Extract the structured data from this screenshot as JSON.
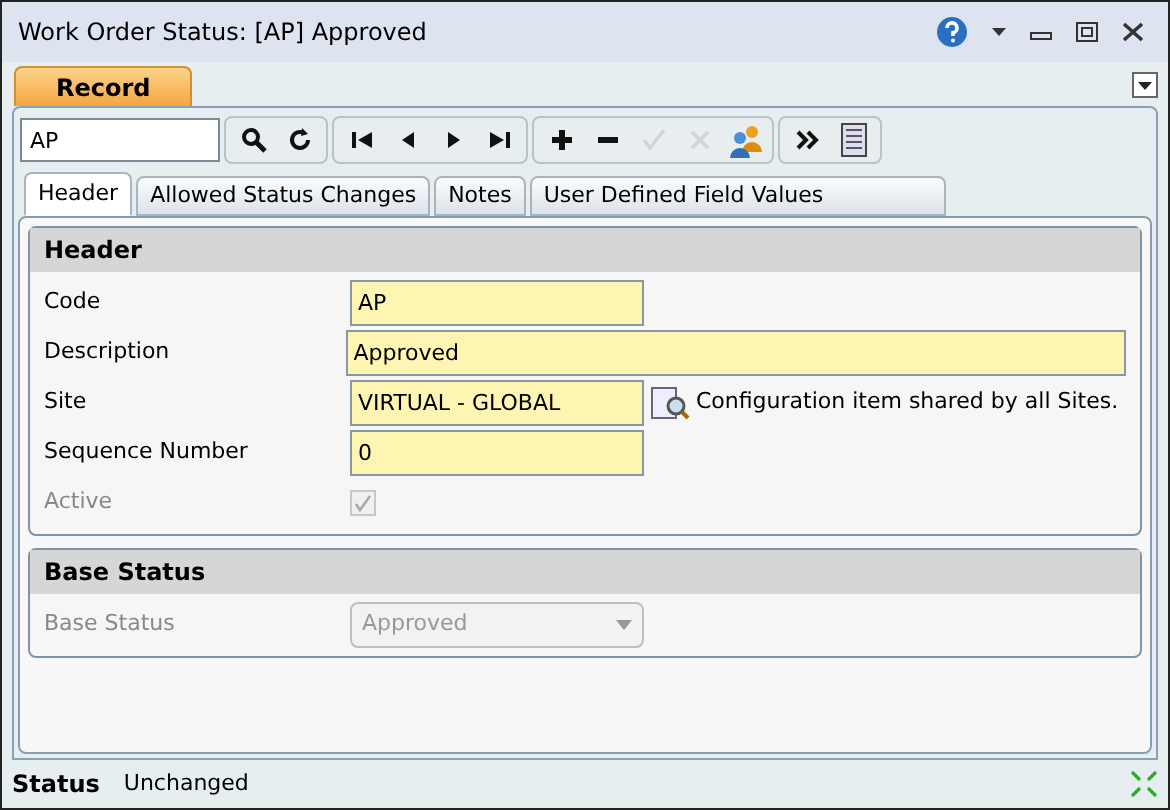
{
  "window": {
    "title": "Work Order Status: [AP] Approved"
  },
  "record_tab": {
    "label": "Record",
    "selected": true
  },
  "search": {
    "value": "AP"
  },
  "toolbar": [
    {
      "kind": "search",
      "disabled": false
    },
    {
      "kind": "refresh",
      "disabled": false
    },
    {
      "kind": "sep"
    },
    {
      "kind": "first",
      "disabled": false
    },
    {
      "kind": "prev",
      "disabled": false
    },
    {
      "kind": "next",
      "disabled": false
    },
    {
      "kind": "last",
      "disabled": false
    },
    {
      "kind": "sep"
    },
    {
      "kind": "add",
      "disabled": false
    },
    {
      "kind": "remove",
      "disabled": false
    },
    {
      "kind": "save",
      "disabled": true
    },
    {
      "kind": "cancel",
      "disabled": true
    },
    {
      "kind": "users",
      "disabled": false
    },
    {
      "kind": "sep"
    },
    {
      "kind": "more",
      "disabled": false
    },
    {
      "kind": "list",
      "disabled": false
    }
  ],
  "tabs": [
    {
      "label": "Header",
      "selected": true
    },
    {
      "label": "Allowed Status Changes",
      "selected": false
    },
    {
      "label": "Notes",
      "selected": false
    },
    {
      "label": "User Defined Field Values",
      "selected": false
    }
  ],
  "sections": [
    {
      "title": "Header",
      "fields": [
        {
          "kind": "short",
          "label": "Code",
          "value": "AP",
          "disabled": false
        },
        {
          "kind": "wide",
          "label": "Description",
          "value": "Approved",
          "disabled": false
        },
        {
          "kind": "short",
          "label": "Site",
          "value": "VIRTUAL - GLOBAL",
          "disabled": false,
          "note": "Configuration item shared by all Sites."
        },
        {
          "kind": "short",
          "label": "Sequence Number",
          "value": "0",
          "disabled": false
        },
        {
          "kind": "checkbox",
          "label": "Active",
          "checked": true,
          "disabled": true
        }
      ]
    },
    {
      "title": "Base Status",
      "fields": [
        {
          "kind": "dropdown",
          "label": "Base Status",
          "value": "Approved",
          "disabled": true
        }
      ]
    }
  ],
  "status_bar": {
    "label": "Status",
    "value": "Unchanged"
  }
}
